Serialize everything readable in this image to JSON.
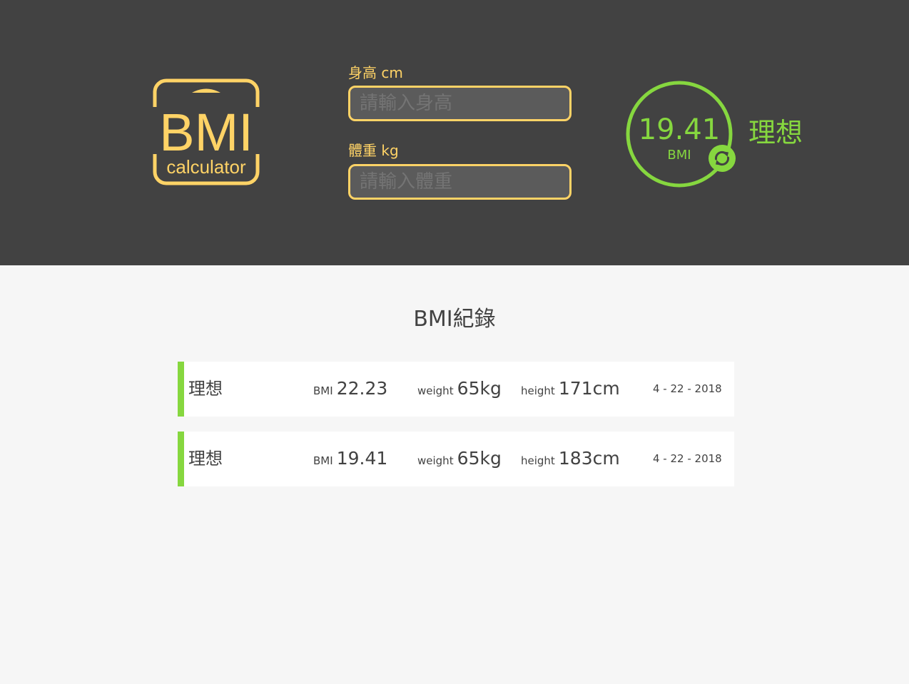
{
  "header": {
    "logo": {
      "text_main": "BMI",
      "text_sub": "calculator"
    },
    "height_field": {
      "label": "身高 cm",
      "placeholder": "請輸入身高",
      "value": ""
    },
    "weight_field": {
      "label": "體重 kg",
      "placeholder": "請輸入體重",
      "value": ""
    },
    "result": {
      "value": "19.41",
      "unit": "BMI",
      "status": "理想",
      "reset_icon": "refresh-icon"
    }
  },
  "records": {
    "title": "BMI紀錄",
    "items": [
      {
        "status": "理想",
        "bmi_label": "BMI",
        "bmi": "22.23",
        "weight_label": "weight",
        "weight": "65kg",
        "height_label": "height",
        "height": "171cm",
        "date": "4 - 22 - 2018"
      },
      {
        "status": "理想",
        "bmi_label": "BMI",
        "bmi": "19.41",
        "weight_label": "weight",
        "weight": "65kg",
        "height_label": "height",
        "height": "183cm",
        "date": "4 - 22 - 2018"
      }
    ]
  },
  "colors": {
    "header_bg": "#424242",
    "page_bg": "#f6f6f6",
    "accent_yellow": "#ffd366",
    "status_green": "#86d73f",
    "text_dark": "#424242"
  }
}
